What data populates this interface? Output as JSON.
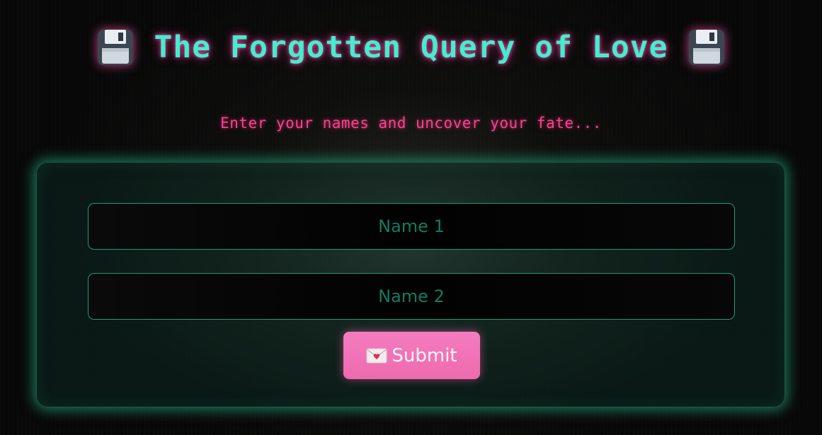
{
  "header": {
    "title": "The Forgotten Query of Love",
    "left_icon": "floppy-disk-icon",
    "right_icon": "floppy-disk-icon"
  },
  "subtitle": "Enter your names and uncover your fate...",
  "form": {
    "name1_placeholder": "Name 1",
    "name1_value": "",
    "name2_placeholder": "Name 2",
    "name2_value": "",
    "submit_label": "Submit",
    "submit_icon": "love-letter-icon"
  },
  "colors": {
    "title": "#3ff0cc",
    "title_glow": "#ff46aa",
    "subtitle": "#ff3f8e",
    "card_glow": "#28c896",
    "input_border": "#1f9a78",
    "placeholder": "#147a62",
    "button": "#f06fb3",
    "background": "#080808"
  }
}
